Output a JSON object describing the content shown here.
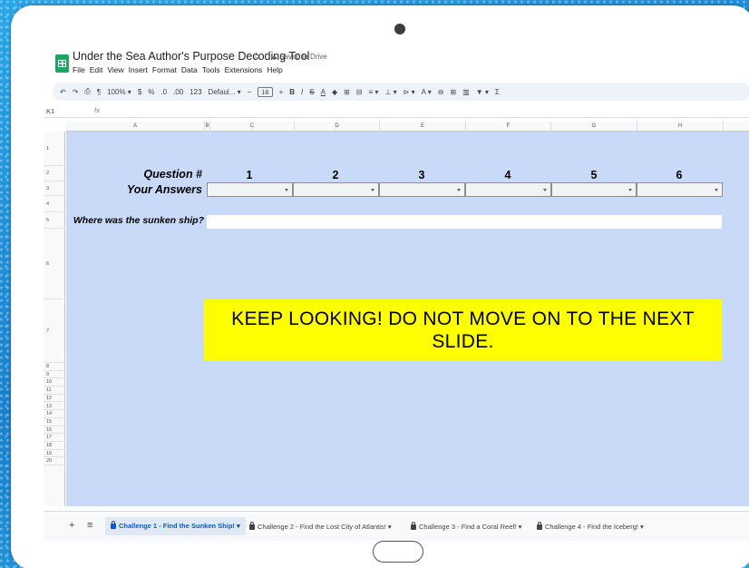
{
  "doc": {
    "title": "Under the Sea Author's Purpose Decoding Tool",
    "star_icon": "☆",
    "cloud_icon": "☁",
    "saved_status": "Saved to Drive",
    "menu": [
      "File",
      "Edit",
      "View",
      "Insert",
      "Format",
      "Data",
      "Tools",
      "Extensions",
      "Help"
    ]
  },
  "toolbar": {
    "undo": "↶",
    "redo": "↷",
    "print": "⎙",
    "paint": "¶",
    "zoom": "100% ▾",
    "currency": "$",
    "percent": "%",
    "dec_minus": ".0",
    "dec_plus": ".00",
    "format_123": "123",
    "font": "Defaul... ▾",
    "minus": "−",
    "font_size": "16",
    "plus": "+",
    "bold": "B",
    "italic": "I",
    "strike": "S",
    "text_color": "A",
    "fill": "◆",
    "borders": "⊞",
    "merge": "⊟",
    "halign": "≡ ▾",
    "valign": "⊥ ▾",
    "wrap": "⊳ ▾",
    "rotate": "A ▾",
    "link": "⊖",
    "comment": "⊞",
    "chart": "▥",
    "filter": "▼ ▾",
    "functions": "Σ"
  },
  "formula_bar": {
    "cell_ref": "K1",
    "fx": "fx"
  },
  "columns": [
    "A",
    "B",
    "C",
    "D",
    "E",
    "F",
    "G",
    "H"
  ],
  "rows": [
    "1",
    "2",
    "3",
    "4",
    "5",
    "6",
    "7",
    "8",
    "9",
    "10",
    "11",
    "12",
    "13",
    "14",
    "15",
    "16",
    "17",
    "18",
    "19",
    "20"
  ],
  "sheet": {
    "question_label": "Question #",
    "answers_label": "Your Answers",
    "question_numbers": [
      "1",
      "2",
      "3",
      "4",
      "5",
      "6"
    ],
    "prompt_label": "Where was the sunken ship?",
    "banner": "KEEP LOOKING! DO NOT MOVE ON TO THE NEXT SLIDE."
  },
  "tabs": {
    "add": "+",
    "all_sheets": "≡",
    "items": [
      "Challenge 1 - Find the Sunken Ship! ▾",
      "Challenge 2 - Find the Lost City of Atlantis! ▾",
      "Challenge 3 - Find a Coral Reef! ▾",
      "Challenge 4 - Find the Iceberg! ▾"
    ]
  },
  "colors": {
    "sheet_bg": "#c9daf8",
    "banner_bg": "#ffff00",
    "active_tab": "#0b57d0",
    "sheets_green": "#1fa463"
  }
}
